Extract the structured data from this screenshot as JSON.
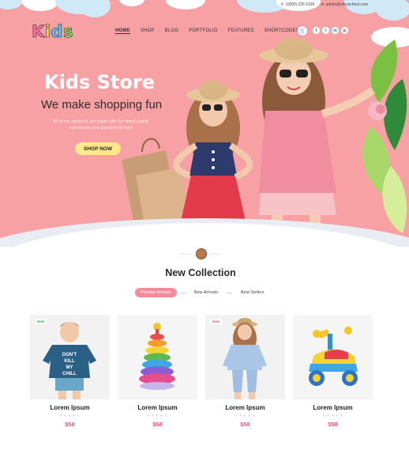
{
  "topbar": {
    "phone": "1(800) 225 6195",
    "email": "admin@ufeyschool.com"
  },
  "logo": {
    "k": "K",
    "i": "i",
    "d": "d",
    "s": "s"
  },
  "nav": {
    "items": [
      "HOME",
      "SHOP",
      "BLOG",
      "PORTFOLIO",
      "FEATURES",
      "SHORTCODES"
    ]
  },
  "social": [
    "f",
    "t",
    "in",
    "p"
  ],
  "hero": {
    "title": "Kids Store",
    "subtitle": "We make shopping fun",
    "description": "All of our products are made with the finest quality ingredients and guaranteed fresh",
    "cta": "SHOP NOW"
  },
  "collection": {
    "title": "New Collection",
    "tabs": [
      "Popular Arrivals",
      "New Arrivals",
      "Best Sellers"
    ]
  },
  "products": [
    {
      "name": "Lorem Ipsum",
      "price": "$58",
      "badge": "New",
      "shirt_text": "DON'T KILL MY CHILL"
    },
    {
      "name": "Lorem Ipsum",
      "price": "$58",
      "badge": ""
    },
    {
      "name": "Lorem Ipsum",
      "price": "$58",
      "badge": "New"
    },
    {
      "name": "Lorem Ipsum",
      "price": "$58",
      "badge": ""
    }
  ],
  "colors": {
    "hero_bg": "#f7a1a4",
    "accent_pink": "#e8537f",
    "cta_yellow": "#ffe98a"
  },
  "icons": {
    "phone": "phone-icon",
    "email": "mail-icon",
    "cart": "cart-icon",
    "stars": "star-icon"
  }
}
